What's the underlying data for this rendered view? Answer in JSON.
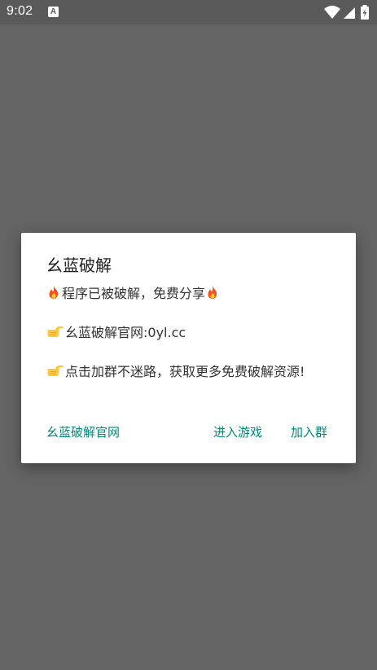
{
  "status_bar": {
    "time": "9:02",
    "notification_badge": "A",
    "icons": [
      "wifi-icon",
      "cell-signal-icon",
      "battery-charging-icon"
    ]
  },
  "dialog": {
    "title": "幺蓝破解",
    "message": {
      "line1_text": "程序已被破解，免费分享",
      "line2_text": "幺蓝破解官网:0yl.cc",
      "line3_text": "点击加群不迷路，获取更多免费破解资源!"
    },
    "buttons": {
      "neutral": "幺蓝破解官网",
      "negative": "进入游戏",
      "positive": "加入群"
    }
  },
  "colors": {
    "scrim": "#646464",
    "dialog_background": "#ffffff",
    "button_text": "#00897b",
    "title_text": "#212121",
    "message_text": "#333333"
  }
}
